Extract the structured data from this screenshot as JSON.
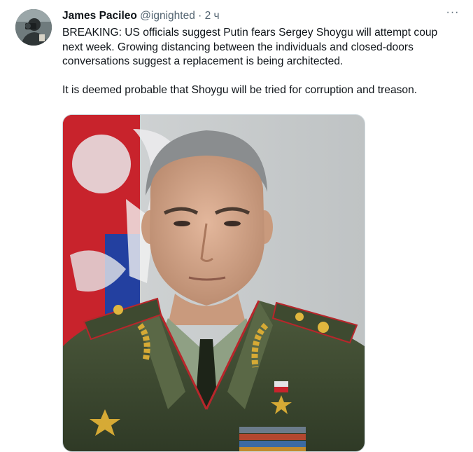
{
  "tweet": {
    "author_name": "James Pacileo",
    "author_handle": "@ignighted",
    "separator": "·",
    "time": "2 ч",
    "more_label": "···",
    "text": "BREAKING: US officials suggest Putin fears Sergey Shoygu will attempt coup next week. Growing distancing between the individuals and closed-doors conversations suggest a replacement is being architected.\n\nIt is deemed probable that Shoygu will be tried for corruption and treason.",
    "avatar_icon": "user-avatar-photo",
    "media_icon": "portrait-photo"
  }
}
